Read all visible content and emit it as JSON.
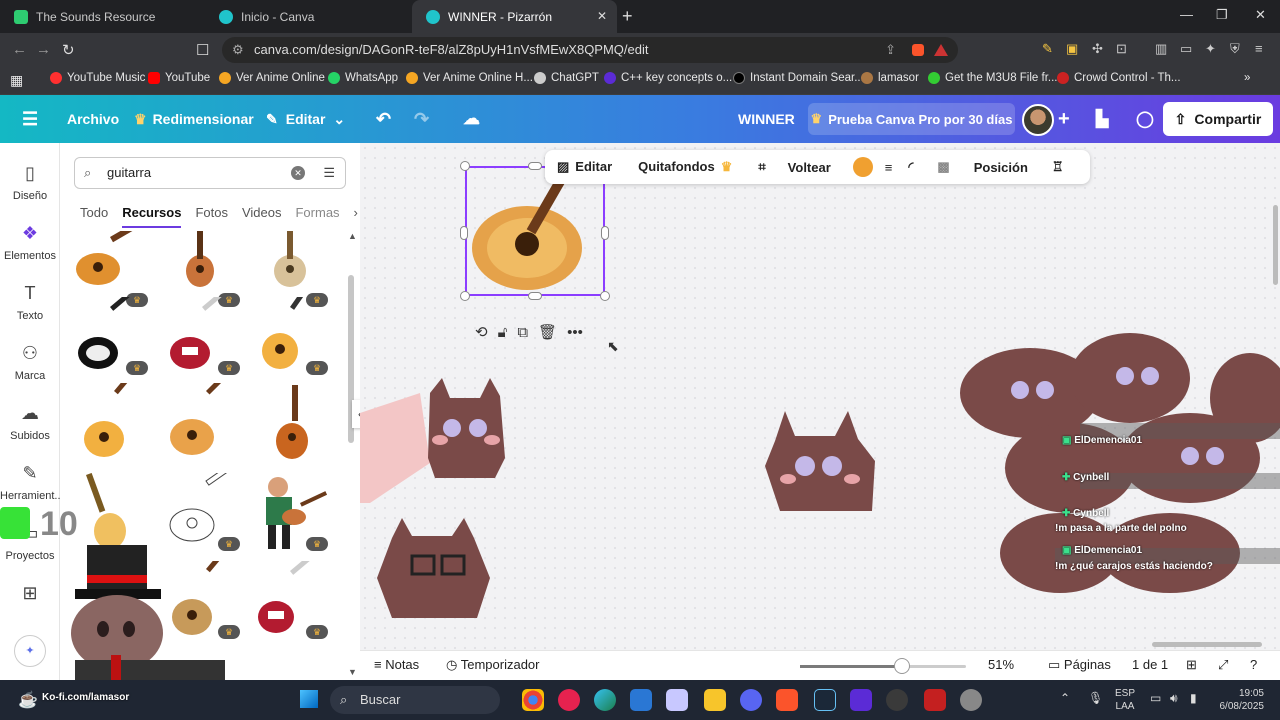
{
  "tabs": [
    {
      "title": "The Sounds Resource",
      "color": "#2ecc71"
    },
    {
      "title": "Inicio - Canva",
      "color": "#20c4cb"
    },
    {
      "title": "WINNER - Pizarrón",
      "color": "#20c4cb"
    }
  ],
  "address": {
    "url": "canva.com/design/DAGonR-teF8/alZ8pUyH1nVsfMEwX8QPMQ/edit"
  },
  "bookmarks": [
    {
      "label": "YouTube Music",
      "color": "#ff3030"
    },
    {
      "label": "YouTube",
      "color": "#ff0000"
    },
    {
      "label": "Ver Anime Online",
      "color": "#f5a623"
    },
    {
      "label": "WhatsApp",
      "color": "#25d366"
    },
    {
      "label": "Ver Anime Online H...",
      "color": "#f5a623"
    },
    {
      "label": "ChatGPT",
      "color": "#cccccc"
    },
    {
      "label": "C++ key concepts o...",
      "color": "#5b2bd6"
    },
    {
      "label": "Instant Domain Sear...",
      "color": "#000000"
    },
    {
      "label": "lamasor",
      "color": "#aa7744"
    },
    {
      "label": "Get the M3U8 File fr...",
      "color": "#33cc33"
    },
    {
      "label": "Crowd Control - Th...",
      "color": "#cc2222"
    }
  ],
  "header": {
    "menu": [
      "Archivo",
      "Redimensionar",
      "Editar"
    ],
    "design_title": "WINNER",
    "pro_cta": "Prueba Canva Pro por 30 días",
    "share": "Compartir"
  },
  "rail": [
    {
      "label": "Diseño"
    },
    {
      "label": "Elementos"
    },
    {
      "label": "Texto"
    },
    {
      "label": "Marca"
    },
    {
      "label": "Subidos"
    },
    {
      "label": "Herramient..."
    },
    {
      "label": "Proyectos"
    }
  ],
  "panel": {
    "query": "guitarra",
    "tabs": [
      "Todo",
      "Recursos",
      "Fotos",
      "Videos",
      "Formas"
    ]
  },
  "context_toolbar": {
    "edit": "Editar",
    "bg_remover": "Quitafondos",
    "flip": "Voltear",
    "position": "Posición",
    "color": "#f0a030"
  },
  "chat": [
    {
      "user": "ElDemencia01"
    },
    {
      "user": "Cynbell"
    },
    {
      "user": "Cynbell",
      "msg": "!m pasa a la parte del polno"
    },
    {
      "user": "ElDemencia01",
      "msg": "!m ¿qué carajos estás haciendo?"
    }
  ],
  "bottom": {
    "notes": "Notas",
    "timer": "Temporizador",
    "zoom": "51%",
    "zoom_level": 0.51,
    "pages": "Páginas",
    "page_count": "1 de 1"
  },
  "taskbar": {
    "search": "Buscar",
    "lang1": "ESP",
    "lang2": "LAA",
    "time": "19:05",
    "date": "6/08/2025"
  },
  "overlay": {
    "counter": "10",
    "kofi": "Ko-fi.com/lamasor"
  }
}
